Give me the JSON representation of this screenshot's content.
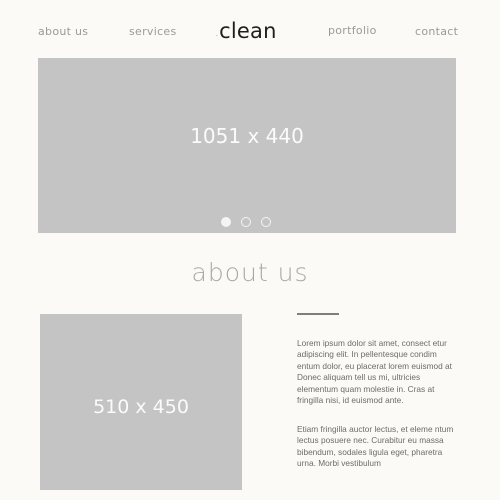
{
  "nav": {
    "about": "about us",
    "services": "services",
    "logo_text": "clean",
    "portfolio": "portfolio",
    "contact": "contact"
  },
  "hero": {
    "placeholder": "1051 x 440",
    "slides": 3,
    "active_slide": 1
  },
  "about": {
    "title": "about us",
    "image_placeholder": "510 x 450",
    "paragraph1": "Lorem ipsum dolor sit amet, consect etur adipiscing elit. In pellentesque condim entum dolor, eu placerat lorem euismod at Donec aliquam tell us mi, ultricies elementum quam molestie in. Cras at fringilla nisi, id euismod ante.",
    "paragraph2": "Etiam fringilla auctor lectus, et eleme ntum lectus posuere nec. Curabitur eu massa bibendum, sodales ligula eget, pharetra urna. Morbi vestibulum"
  },
  "colors": {
    "background": "#fbfaf6",
    "placeholder": "#c4c4c4",
    "nav_text": "#9a9a9a",
    "logo": "#1e1e1e"
  }
}
